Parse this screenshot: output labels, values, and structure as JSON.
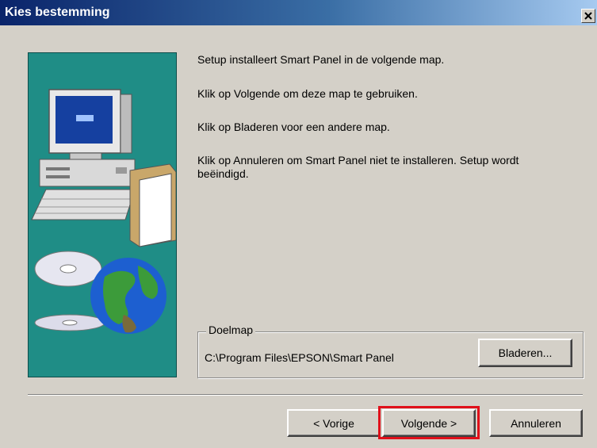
{
  "window": {
    "title": "Kies bestemming"
  },
  "content": {
    "line1": "Setup installeert Smart Panel in de volgende map.",
    "line2": "Klik op Volgende om deze map te gebruiken.",
    "line3": "Klik op Bladeren voor een andere map.",
    "line4a": "Klik op Annuleren om Smart Panel niet te installeren. Setup wordt",
    "line4b": "beëindigd."
  },
  "destination": {
    "group_label": "Doelmap",
    "path": "C:\\Program Files\\EPSON\\Smart Panel",
    "browse_label": "Bladeren..."
  },
  "buttons": {
    "back_label": "< Vorige",
    "next_label": "Volgende >",
    "cancel_label": "Annuleren"
  },
  "colors": {
    "accent_highlight": "#e0101a",
    "side_panel": "#1f8d86",
    "title_bar": "#0a246a"
  },
  "icons": {
    "close": "close-icon",
    "illustration": "computer-cd-globe-illustration"
  }
}
